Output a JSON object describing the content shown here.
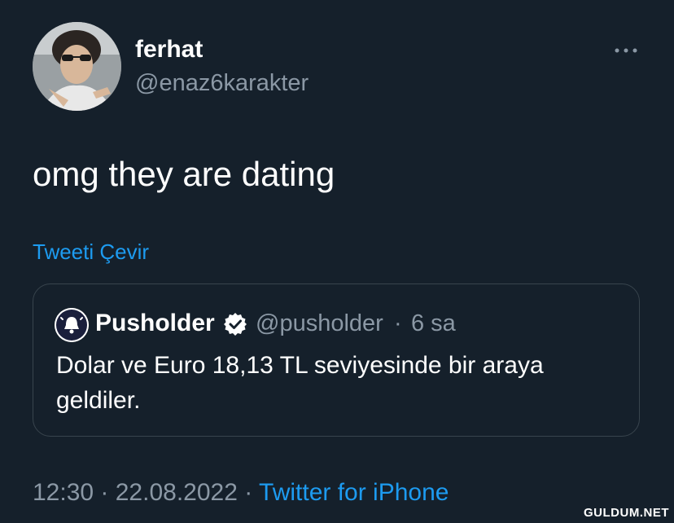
{
  "author": {
    "display_name": "ferhat",
    "handle": "@enaz6karakter",
    "avatar_icon": "profile-photo"
  },
  "header": {
    "more_icon": "ellipsis-icon"
  },
  "tweet": {
    "text": "omg they are dating",
    "translate_label": "Tweeti Çevir"
  },
  "quote": {
    "display_name": "Pusholder",
    "verified_icon": "verified-badge-icon",
    "handle": "@pusholder",
    "separator": "·",
    "time": "6 sa",
    "text": "Dolar ve Euro 18,13 TL seviyesinde bir araya geldiler."
  },
  "meta": {
    "time": "12:30",
    "separator1": " · ",
    "date": "22.08.2022",
    "separator2": " · ",
    "source": "Twitter for iPhone"
  },
  "watermark": "GULDUM.NET",
  "colors": {
    "background": "#15202b",
    "text_primary": "#ffffff",
    "text_secondary": "#8b98a5",
    "link": "#1d9bf0",
    "border": "#38444d"
  }
}
